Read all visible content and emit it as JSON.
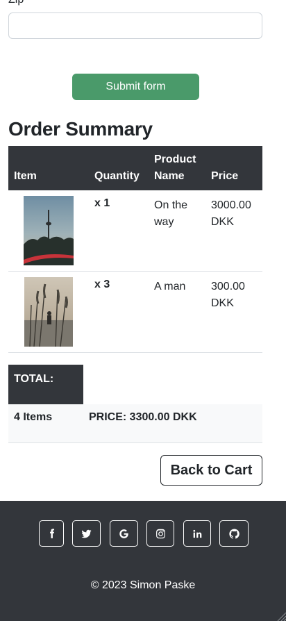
{
  "form": {
    "zip_label": "Zip",
    "zip_value": "",
    "submit_label": "Submit form"
  },
  "summary": {
    "title": "Order Summary",
    "headers": {
      "item": "Item",
      "quantity": "Quantity",
      "product_name": "Product Name",
      "price": "Price"
    },
    "rows": [
      {
        "quantity": "x 1",
        "name": "On the way",
        "price": "3000.00 DKK",
        "image": "tower-photo"
      },
      {
        "quantity": "x 3",
        "name": "A man",
        "price": "300.00 DKK",
        "image": "grass-photo"
      }
    ],
    "total_label": "TOTAL:",
    "total_items": "4 Items",
    "total_price": "PRICE: 3300.00 DKK"
  },
  "back_label": "Back to Cart",
  "footer": {
    "icons": [
      "facebook-icon",
      "twitter-icon",
      "google-icon",
      "instagram-icon",
      "linkedin-icon",
      "github-icon"
    ],
    "copyright": "© 2023 Simon Paske"
  }
}
